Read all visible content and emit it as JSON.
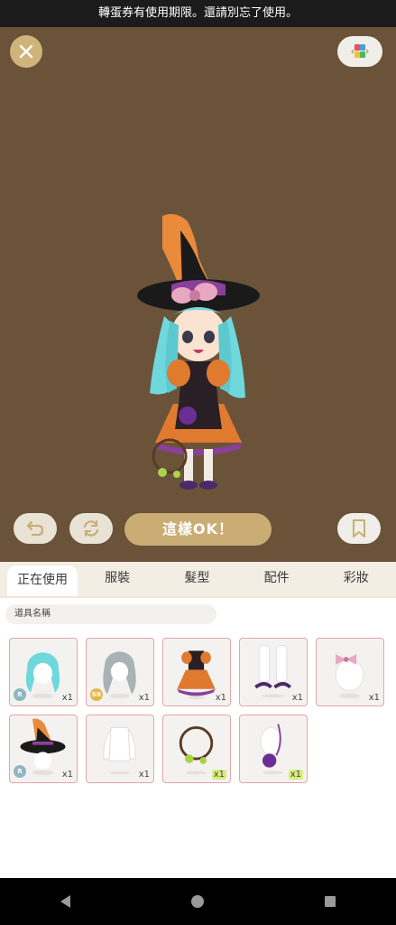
{
  "notice": {
    "text": "轉蛋券有使用期限。還請別忘了使用。"
  },
  "actions": {
    "ok_label": "這樣OK！"
  },
  "tabs": [
    {
      "label": "正在使用"
    },
    {
      "label": "服裝"
    },
    {
      "label": "髮型"
    },
    {
      "label": "配件"
    },
    {
      "label": "彩妝"
    }
  ],
  "search": {
    "label": "道具名稱"
  },
  "items": [
    {
      "icon": "cyan-hair-icon",
      "rarity": "R",
      "qty": "x1"
    },
    {
      "icon": "gray-hair-icon",
      "rarity": "SR",
      "qty": "x1"
    },
    {
      "icon": "halloween-dress-icon",
      "rarity": "",
      "qty": "x1"
    },
    {
      "icon": "boots-icon",
      "rarity": "",
      "qty": "x1"
    },
    {
      "icon": "pink-bow-icon",
      "rarity": "",
      "qty": "x1"
    },
    {
      "icon": "witch-hat-icon",
      "rarity": "R",
      "qty": "x1"
    },
    {
      "icon": "inner-top-icon",
      "rarity": "",
      "qty": "x1"
    },
    {
      "icon": "vine-wreath-icon",
      "rarity": "",
      "qty": "x1"
    },
    {
      "icon": "purple-charm-icon",
      "rarity": "",
      "qty": "x1"
    }
  ],
  "colors": {
    "stage_bg": "#6b5339",
    "accent_gold": "#c9ad74",
    "tab_bar": "#f2eee4"
  }
}
